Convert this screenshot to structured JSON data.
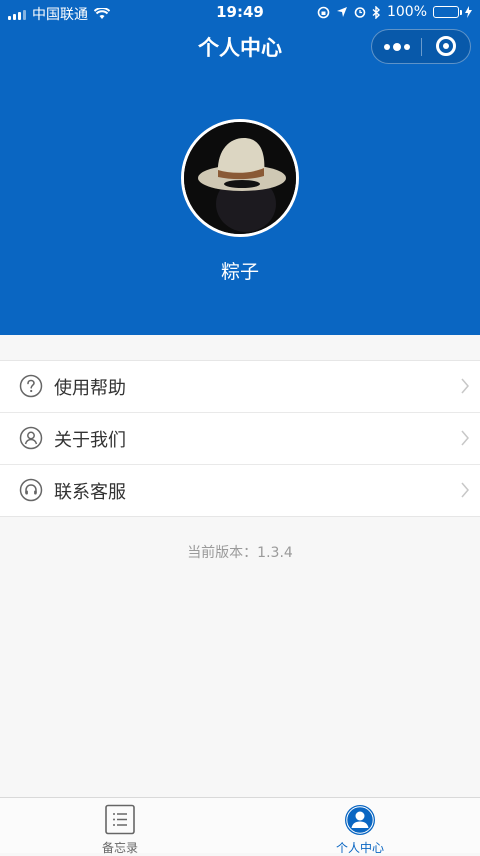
{
  "status_bar": {
    "carrier": "中国联通",
    "time": "19:49",
    "battery": "100%",
    "battery_level": 1.0
  },
  "nav": {
    "title": "个人中心"
  },
  "profile": {
    "username": "粽子"
  },
  "menu": {
    "items": [
      {
        "label": "使用帮助",
        "icon": "question-circle-icon"
      },
      {
        "label": "关于我们",
        "icon": "user-circle-icon"
      },
      {
        "label": "联系客服",
        "icon": "headset-circle-icon"
      }
    ]
  },
  "footer": {
    "version": "当前版本：1.3.4"
  },
  "tabbar": {
    "tabs": [
      {
        "label": "备忘录",
        "icon": "notes-list-icon",
        "active": false
      },
      {
        "label": "个人中心",
        "icon": "person-icon",
        "active": true
      }
    ]
  },
  "colors": {
    "primary": "#0a66c2",
    "tab_active": "#0a66c2",
    "tab_inactive": "#666666",
    "page_bg": "#f7f7f7"
  }
}
